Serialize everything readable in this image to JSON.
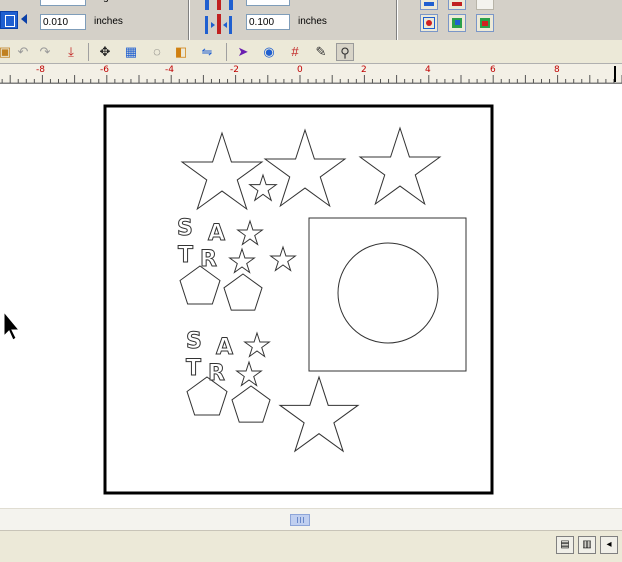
{
  "property_bar": {
    "angle_unit": "degrees",
    "line_width_value": "0.010",
    "line_width_unit": "inches",
    "spacing_value": "0.100",
    "spacing_unit": "inches"
  },
  "toolbar": {
    "icons": [
      "paste-icon",
      "undo-icon",
      "redo-icon",
      "import-icon",
      "move-icon",
      "group-icon",
      "rotate-icon",
      "fill-icon",
      "mirror-icon",
      "select-icon",
      "view-icon",
      "grid-icon",
      "node-edit-icon",
      "weld-icon"
    ]
  },
  "ruler": {
    "labels": [
      "-8",
      "-6",
      "-4",
      "-2",
      "0",
      "2",
      "4",
      "6",
      "8"
    ]
  },
  "canvas": {
    "text_shapes": {
      "letter_s": "S",
      "letter_a": "A",
      "letter_t": "T",
      "letter_r": "R"
    }
  },
  "status_bar": {
    "icons": [
      "page-icon",
      "page-add-icon",
      "scroll-left-icon"
    ]
  },
  "colors": {
    "toolbar_bg": "#ece9d8",
    "ruler_label": "#c00000",
    "accent": "#0a3fa8"
  }
}
